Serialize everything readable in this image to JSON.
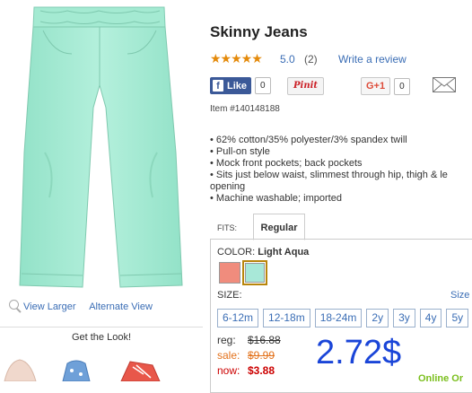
{
  "product": {
    "title": "Skinny Jeans",
    "stars": "★★★★★",
    "rating": "5.0",
    "review_count": "(2)",
    "write_review": "Write a review",
    "item_number": "Item #140148188",
    "image_icon": "pants-image",
    "pants_color": "#a8ecd5"
  },
  "social": {
    "like_label": "Like",
    "like_count": "0",
    "pin_label": "Pinit",
    "gplus_label": "G+1",
    "gplus_count": "0"
  },
  "image_links": {
    "view_larger": "View Larger",
    "alternate_view": "Alternate View"
  },
  "get_look": {
    "title": "Get the Look!"
  },
  "bullets": [
    "62% cotton/35% polyester/3% spandex twill",
    "Pull-on style",
    "Mock front pockets; back pockets",
    "Sits just below waist, slimmest through hip, thigh & le",
    "opening",
    "Machine washable; imported"
  ],
  "fit": {
    "label": "FITS:",
    "selected": "Regular"
  },
  "color": {
    "label": "COLOR:",
    "selected": "Light Aqua",
    "swatches": [
      "#f08c7d",
      "#a8e8d8"
    ]
  },
  "size": {
    "label": "SIZE:",
    "chart_link": "Size",
    "options": [
      "6-12m",
      "12-18m",
      "18-24m",
      "2y",
      "3y",
      "4y",
      "5y"
    ]
  },
  "pricing": {
    "reg_label": "reg:",
    "reg_price": "$16.88",
    "sale_label": "sale:",
    "sale_price": "$9.99",
    "now_label": "now:",
    "now_price": "$3.88",
    "big_price": "2.72$",
    "green_partial": "Online Or"
  }
}
